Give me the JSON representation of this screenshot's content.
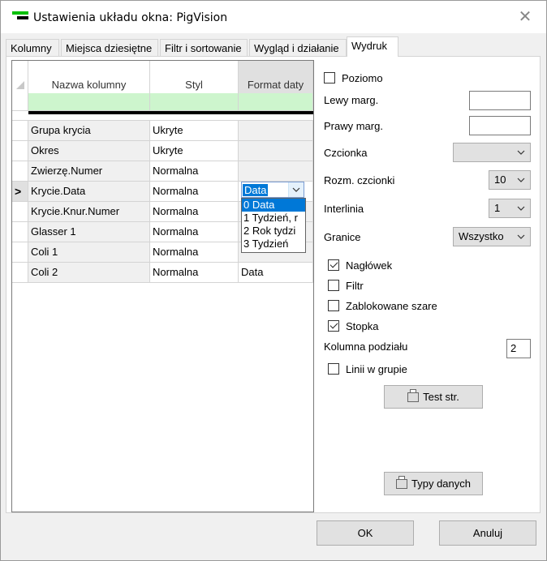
{
  "window": {
    "title": "Ustawienia układu okna: PigVision"
  },
  "tabs": [
    {
      "label": "Kolumny"
    },
    {
      "label": "Miejsca dziesiętne"
    },
    {
      "label": "Filtr i sortowanie"
    },
    {
      "label": "Wygląd i działanie"
    },
    {
      "label": "Wydruk",
      "active": true
    }
  ],
  "grid": {
    "headers": {
      "name": "Nazwa kolumny",
      "style": "Styl",
      "date_format": "Format daty"
    },
    "rows": [
      {
        "marker": "",
        "name": "Grupa krycia",
        "style": "Ukryte",
        "date_format": ""
      },
      {
        "marker": "",
        "name": "Okres",
        "style": "Ukryte",
        "date_format": ""
      },
      {
        "marker": "",
        "name": "Zwierzę.Numer",
        "style": "Normalna",
        "date_format": ""
      },
      {
        "marker": ">",
        "name": "Krycie.Data",
        "style": "Normalna",
        "date_format": ""
      },
      {
        "marker": "",
        "name": "Krycie.Knur.Numer",
        "style": "Normalna",
        "date_format": ""
      },
      {
        "marker": "",
        "name": "Glasser 1",
        "style": "Normalna",
        "date_format": ""
      },
      {
        "marker": "",
        "name": "Coli 1",
        "style": "Normalna",
        "date_format": ""
      },
      {
        "marker": "",
        "name": "Coli 2",
        "style": "Normalna",
        "date_format": "Data"
      }
    ],
    "date_dropdown": {
      "value": "Data",
      "options": [
        "0 Data",
        "1 Tydzień, r",
        "2 Rok tydzi",
        "3 Tydzień"
      ]
    }
  },
  "print": {
    "landscape": {
      "label": "Poziomo",
      "checked": false
    },
    "left_margin": {
      "label": "Lewy marg.",
      "value": ""
    },
    "right_margin": {
      "label": "Prawy marg.",
      "value": ""
    },
    "font": {
      "label": "Czcionka",
      "value": ""
    },
    "font_size": {
      "label": "Rozm. czcionki",
      "value": "10"
    },
    "line_spacing": {
      "label": "Interlinia",
      "value": "1"
    },
    "borders": {
      "label": "Granice",
      "value": "Wszystko"
    },
    "header": {
      "label": "Nagłówek",
      "checked": true
    },
    "filter": {
      "label": "Filtr",
      "checked": false
    },
    "locked_gray": {
      "label": "Zablokowane szare",
      "checked": false
    },
    "footer": {
      "label": "Stopka",
      "checked": true
    },
    "split_column": {
      "label": "Kolumna podziału",
      "value": "2"
    },
    "group_lines": {
      "label": "Linii w grupie",
      "checked": false
    },
    "test_page": {
      "label": "Test str."
    },
    "data_types": {
      "label": "Typy danych"
    }
  },
  "buttons": {
    "ok": "OK",
    "cancel": "Anuluj"
  },
  "icons": {
    "close": "close-icon",
    "printer": "printer-icon",
    "dropdown": "chevron-down-icon"
  }
}
